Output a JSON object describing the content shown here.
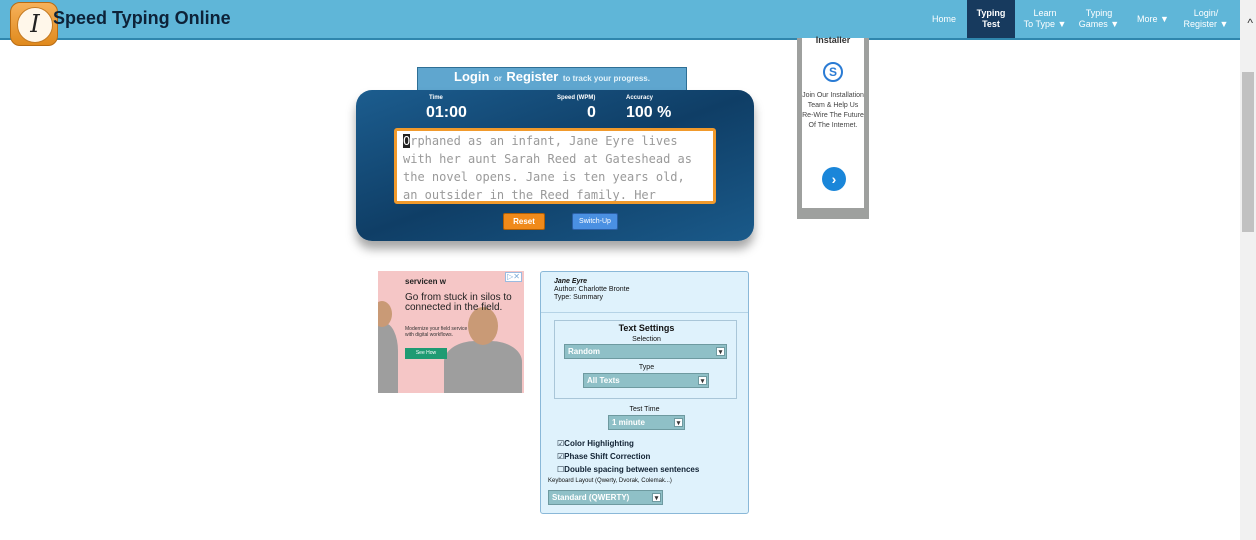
{
  "header": {
    "site_title": "Speed Typing Online",
    "logo_letter": "I",
    "nav": [
      {
        "line1": "Home",
        "line2": ""
      },
      {
        "line1": "Typing",
        "line2": "Test"
      },
      {
        "line1": "Learn",
        "line2": "To Type ▼"
      },
      {
        "line1": "Typing",
        "line2": "Games ▼"
      },
      {
        "line1": "More ▼",
        "line2": ""
      },
      {
        "line1": "Login/",
        "line2": "Register ▼"
      }
    ]
  },
  "login_tab": {
    "login": "Login",
    "or": "or",
    "register": "Register",
    "suffix": "to track your progress."
  },
  "stats": {
    "time_label": "Time",
    "time_value": "01:00",
    "speed_label": "Speed (WPM)",
    "speed_value": "0",
    "accuracy_label": "Accuracy",
    "accuracy_value": "100 %"
  },
  "typing_text": {
    "first_char": "O",
    "line1_rest": "rphaned as an infant, Jane Eyre lives",
    "line2": "with her aunt Sarah Reed at Gateshead as",
    "line3": "the novel opens. Jane is ten years old,",
    "line4": "an outsider in the Reed family. Her"
  },
  "buttons": {
    "reset": "Reset",
    "switch_up": "Switch-Up"
  },
  "installer_ad": {
    "title": "Installer",
    "logo": "S",
    "text": "Join Our Installation Team & Help Us Re-Wire The Future Of The Internet.",
    "arrow": "›"
  },
  "servicenow_ad": {
    "brand": "servicen w",
    "headline": "Go from stuck in silos to connected in the field.",
    "subtext": "Modernize your field service with digital workflows.",
    "cta": "See How",
    "close": "▷✕"
  },
  "book": {
    "title": "Jane Eyre",
    "author": "Author: Charlotte Bronte",
    "type": "Type: Summary"
  },
  "text_settings": {
    "title": "Text Settings",
    "selection_label": "Selection",
    "selection_value": "Random",
    "type_label": "Type",
    "type_value": "All Texts",
    "test_time_label": "Test Time",
    "test_time_value": "1 minute"
  },
  "options": {
    "color_highlighting": "Color Highlighting",
    "phase_shift": "Phase Shift Correction",
    "double_spacing": "Double spacing between sentences",
    "checked_box": "☑",
    "unchecked_box": "☐"
  },
  "keyboard": {
    "label": "Keyboard Layout (Qwerty, Dvorak, Colemak...)",
    "value": "Standard (QWERTY)"
  },
  "scroll": {
    "up_arrow": "^"
  },
  "colors": {
    "header": "#5fb6d8",
    "panel": "#0f3e66",
    "accent_orange": "#f19a2c",
    "settings_bg": "#dff2fc"
  }
}
